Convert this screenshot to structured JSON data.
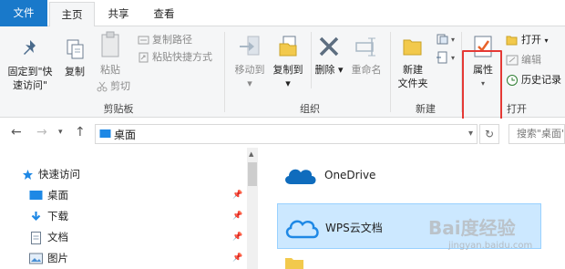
{
  "tabs": {
    "file": "文件",
    "home": "主页",
    "share": "共享",
    "view": "查看"
  },
  "ribbon": {
    "pin_quick_access": [
      "固定到\"快",
      "速访问\""
    ],
    "copy": "复制",
    "paste": "粘贴",
    "copy_path": "复制路径",
    "paste_shortcut": "粘贴快捷方式",
    "cut": "剪切",
    "clipboard_group": "剪贴板",
    "move_to": "移动到",
    "copy_to": "复制到",
    "delete": "删除",
    "rename": "重命名",
    "organize_group": "组织",
    "new_folder": [
      "新建",
      "文件夹"
    ],
    "new_group": "新建",
    "properties": "属性",
    "open": "打开",
    "edit": "编辑",
    "history": "历史记录",
    "open_group": "打开"
  },
  "navbar": {
    "address": "桌面",
    "search_placeholder": "搜索\"桌面\""
  },
  "nav_pane": [
    {
      "label": "快速访问",
      "icon": "star-icon"
    },
    {
      "label": "桌面",
      "icon": "desktop-icon",
      "pinned": true
    },
    {
      "label": "下载",
      "icon": "download-icon",
      "pinned": true
    },
    {
      "label": "文档",
      "icon": "document-icon",
      "pinned": true
    },
    {
      "label": "图片",
      "icon": "picture-icon",
      "pinned": true
    }
  ],
  "files": [
    {
      "name": "OneDrive",
      "icon": "onedrive-cloud-icon"
    },
    {
      "name": "WPS云文档",
      "icon": "wps-cloud-icon",
      "selected": true
    }
  ],
  "watermark": {
    "brand": "Bai度经验",
    "url": "jingyan.baidu.com"
  },
  "colors": {
    "accent": "#1979ca",
    "highlight_box": "#e53935",
    "selected_bg": "#cce8ff"
  }
}
